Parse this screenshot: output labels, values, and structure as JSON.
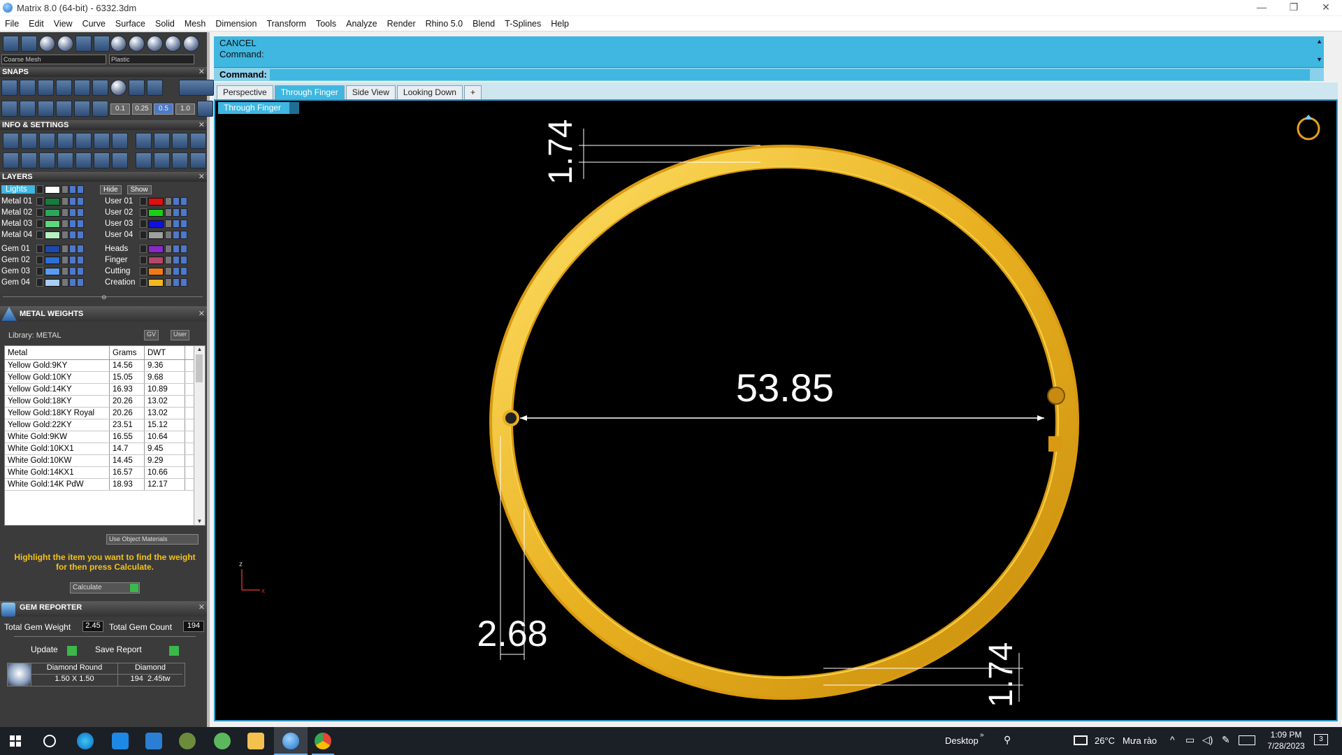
{
  "window": {
    "title": "Matrix 8.0 (64-bit) - 6332.3dm",
    "minimize": "—",
    "maximize": "❐",
    "close": "✕"
  },
  "menu": [
    "File",
    "Edit",
    "View",
    "Curve",
    "Surface",
    "Solid",
    "Mesh",
    "Dimension",
    "Transform",
    "Tools",
    "Analyze",
    "Render",
    "Rhino 5.0",
    "Blend",
    "T-Splines",
    "Help"
  ],
  "left": {
    "mesh_select": "Coarse Mesh",
    "material_select": "Plastic",
    "snaps_title": "SNAPS",
    "snap_values": [
      "0.1",
      "0.25",
      "0.5",
      "1.0"
    ],
    "info_title": "INFO & SETTINGS",
    "layers_title": "LAYERS",
    "lights_label": "Lights",
    "hide_label": "Hide",
    "show_label": "Show",
    "layers_left": [
      {
        "name": "Metal 01",
        "color": "#1a7a3c"
      },
      {
        "name": "Metal 02",
        "color": "#2aa85a"
      },
      {
        "name": "Metal 03",
        "color": "#5ed67a"
      },
      {
        "name": "Metal 04",
        "color": "#b6efc0"
      },
      {
        "name": "Gem 01",
        "color": "#1f49a8"
      },
      {
        "name": "Gem 02",
        "color": "#2e6fd6"
      },
      {
        "name": "Gem 03",
        "color": "#5b9af0"
      },
      {
        "name": "Gem 04",
        "color": "#a8cdf7"
      }
    ],
    "layers_right": [
      {
        "name": "User 01",
        "color": "#e01010"
      },
      {
        "name": "User 02",
        "color": "#18d018"
      },
      {
        "name": "User 03",
        "color": "#1010e0"
      },
      {
        "name": "User 04",
        "color": "#a0a0a0"
      },
      {
        "name": "Heads",
        "color": "#8a28c8"
      },
      {
        "name": "Finger",
        "color": "#b8456a"
      },
      {
        "name": "Cutting",
        "color": "#f07a18"
      },
      {
        "name": "Creation",
        "color": "#f4b81c"
      }
    ],
    "metal_weights_title": "METAL WEIGHTS",
    "library_label": "Library: METAL",
    "gv_btn": "GV",
    "user_btn": "User",
    "metal_headers": [
      "Metal",
      "Grams",
      "DWT"
    ],
    "metals": [
      [
        "Yellow Gold:9KY",
        "14.56",
        "9.36"
      ],
      [
        "Yellow Gold:10KY",
        "15.05",
        "9.68"
      ],
      [
        "Yellow Gold:14KY",
        "16.93",
        "10.89"
      ],
      [
        "Yellow Gold:18KY",
        "20.26",
        "13.02"
      ],
      [
        "Yellow Gold:18KY Royal",
        "20.26",
        "13.02"
      ],
      [
        "Yellow Gold:22KY",
        "23.51",
        "15.12"
      ],
      [
        "White Gold:9KW",
        "16.55",
        "10.64"
      ],
      [
        "White Gold:10KX1",
        "14.7",
        "9.45"
      ],
      [
        "White Gold:10KW",
        "14.45",
        "9.29"
      ],
      [
        "White Gold:14KX1",
        "16.57",
        "10.66"
      ],
      [
        "White Gold:14K PdW",
        "18.93",
        "12.17"
      ]
    ],
    "use_object_materials": "Use Object Materials",
    "hint": "Highlight the item you want to find the weight for then press Calculate.",
    "calculate": "Calculate",
    "gem_reporter_title": "GEM REPORTER",
    "total_gem_weight_label": "Total Gem Weight",
    "total_gem_weight": "2.45",
    "total_gem_count_label": "Total Gem Count",
    "total_gem_count": "194",
    "update": "Update",
    "save_report": "Save Report",
    "gem": {
      "shape": "Diamond Round",
      "size": "1.50 X 1.50",
      "type": "Diamond",
      "count": "194",
      "weight": "2.45tw"
    }
  },
  "command": {
    "line1": "CANCEL",
    "line2": "Command:",
    "prompt": "Command:"
  },
  "tabs": [
    "Perspective",
    "Through Finger",
    "Side View",
    "Looking Down",
    "+"
  ],
  "active_tab": "Through Finger",
  "viewport": {
    "label": "Through Finger",
    "dim_diameter": "53.85",
    "dim_top": "1.74",
    "dim_bottom": "1.74",
    "dim_width": "2.68",
    "axis_z": "z",
    "axis_x": "x"
  },
  "taskbar": {
    "desktop": "Desktop",
    "temperature": "26°C",
    "weather": "Mưa rào",
    "time": "1:09 PM",
    "date": "7/28/2023",
    "notifications": "3"
  }
}
